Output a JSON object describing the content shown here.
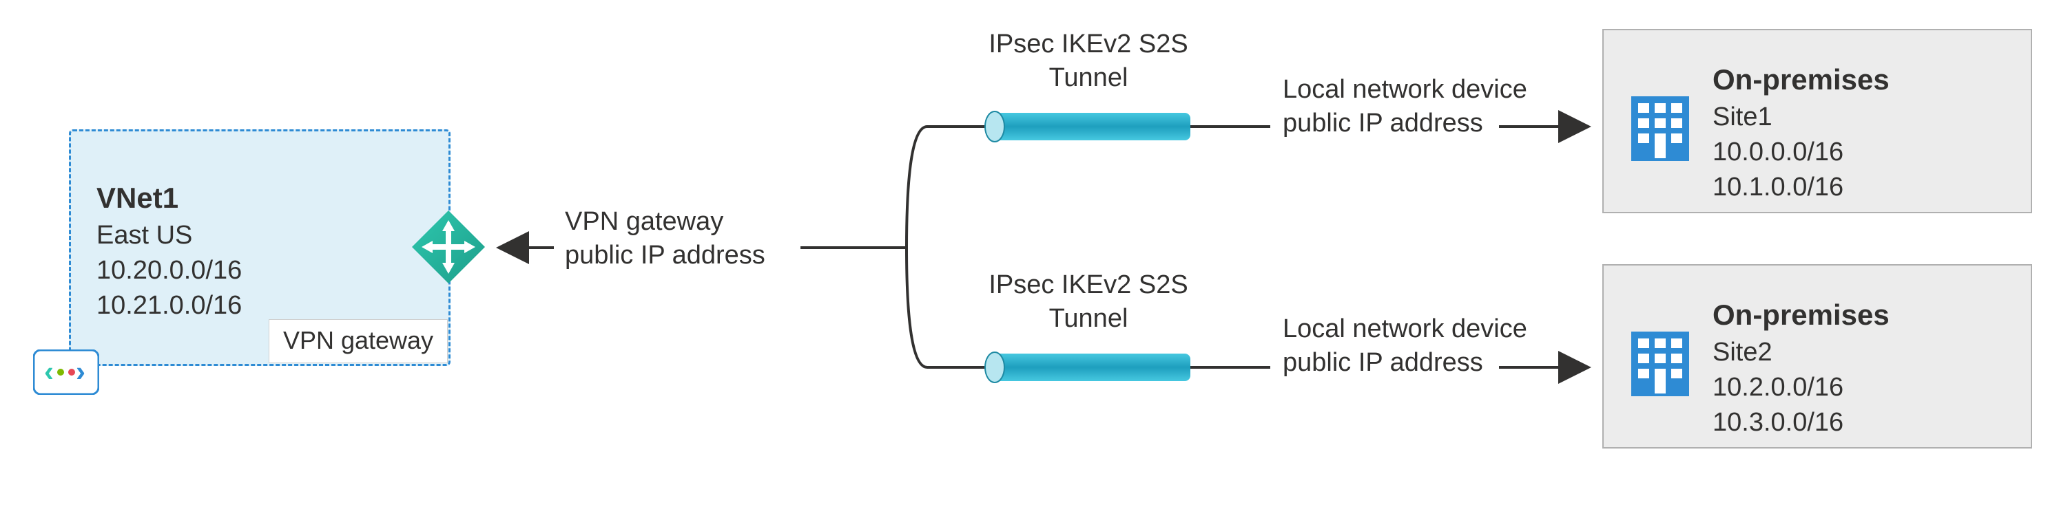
{
  "vnet": {
    "title": "VNet1",
    "region": "East US",
    "cidr1": "10.20.0.0/16",
    "cidr2": "10.21.0.0/16",
    "icon_label": "VNet icon",
    "gateway_label": "VPN gateway"
  },
  "gateway": {
    "label_line1": "VPN gateway",
    "label_line2": "public IP address"
  },
  "tunnel_top": {
    "line1": "IPsec IKEv2 S2S",
    "line2": "Tunnel"
  },
  "tunnel_bottom": {
    "line1": "IPsec IKEv2 S2S",
    "line2": "Tunnel"
  },
  "local_top": {
    "line1": "Local network device",
    "line2": "public IP address"
  },
  "local_bottom": {
    "line1": "Local network device",
    "line2": "public IP address"
  },
  "onprem_top": {
    "title": "On-premises",
    "site": "Site1",
    "cidr1": "10.0.0.0/16",
    "cidr2": "10.1.0.0/16"
  },
  "onprem_bottom": {
    "title": "On-premises",
    "site": "Site2",
    "cidr1": "10.2.0.0/16",
    "cidr2": "10.3.0.0/16"
  },
  "colors": {
    "line": "#323130",
    "tunnel_fill": "#29B6D6",
    "tunnel_stroke": "#1E8AA3",
    "vnet_bg": "#DFF0F8",
    "vnet_border": "#2E8BD4",
    "onprem_bg": "#ECECEC",
    "onprem_border": "#B0B0B0",
    "gw_diamond_a": "#1E9E8A",
    "gw_diamond_b": "#2DC7AE",
    "building": "#2E8BD4"
  }
}
